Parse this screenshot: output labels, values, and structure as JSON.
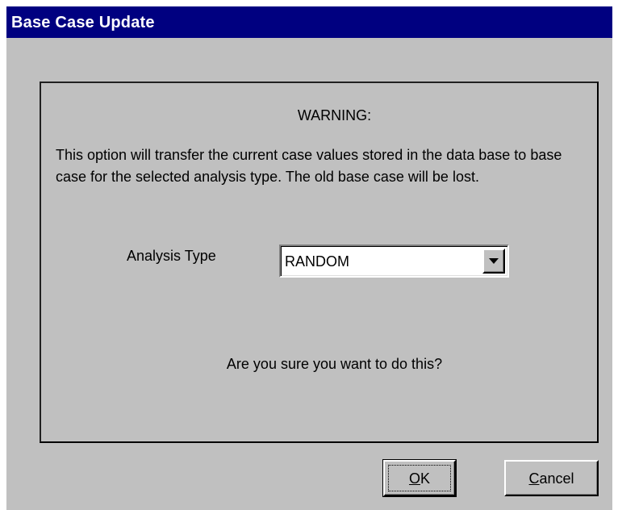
{
  "window": {
    "title": "Base Case Update"
  },
  "warning": {
    "heading": "WARNING:",
    "message": "This option will transfer the current case values stored in the data base to base case for the selected analysis type.  The old base case will be lost."
  },
  "analysis_type": {
    "label": "Analysis Type",
    "selected": "RANDOM"
  },
  "confirm": {
    "question": "Are you sure you want to do this?"
  },
  "buttons": {
    "ok": {
      "mnemonic": "O",
      "rest": "K"
    },
    "cancel": {
      "mnemonic": "C",
      "rest": "ancel"
    }
  },
  "colors": {
    "title_bar": "#000080",
    "title_text": "#ffffff",
    "dialog_face": "#c0c0c0"
  },
  "icons": {
    "dropdown": "chevron-down-icon"
  }
}
